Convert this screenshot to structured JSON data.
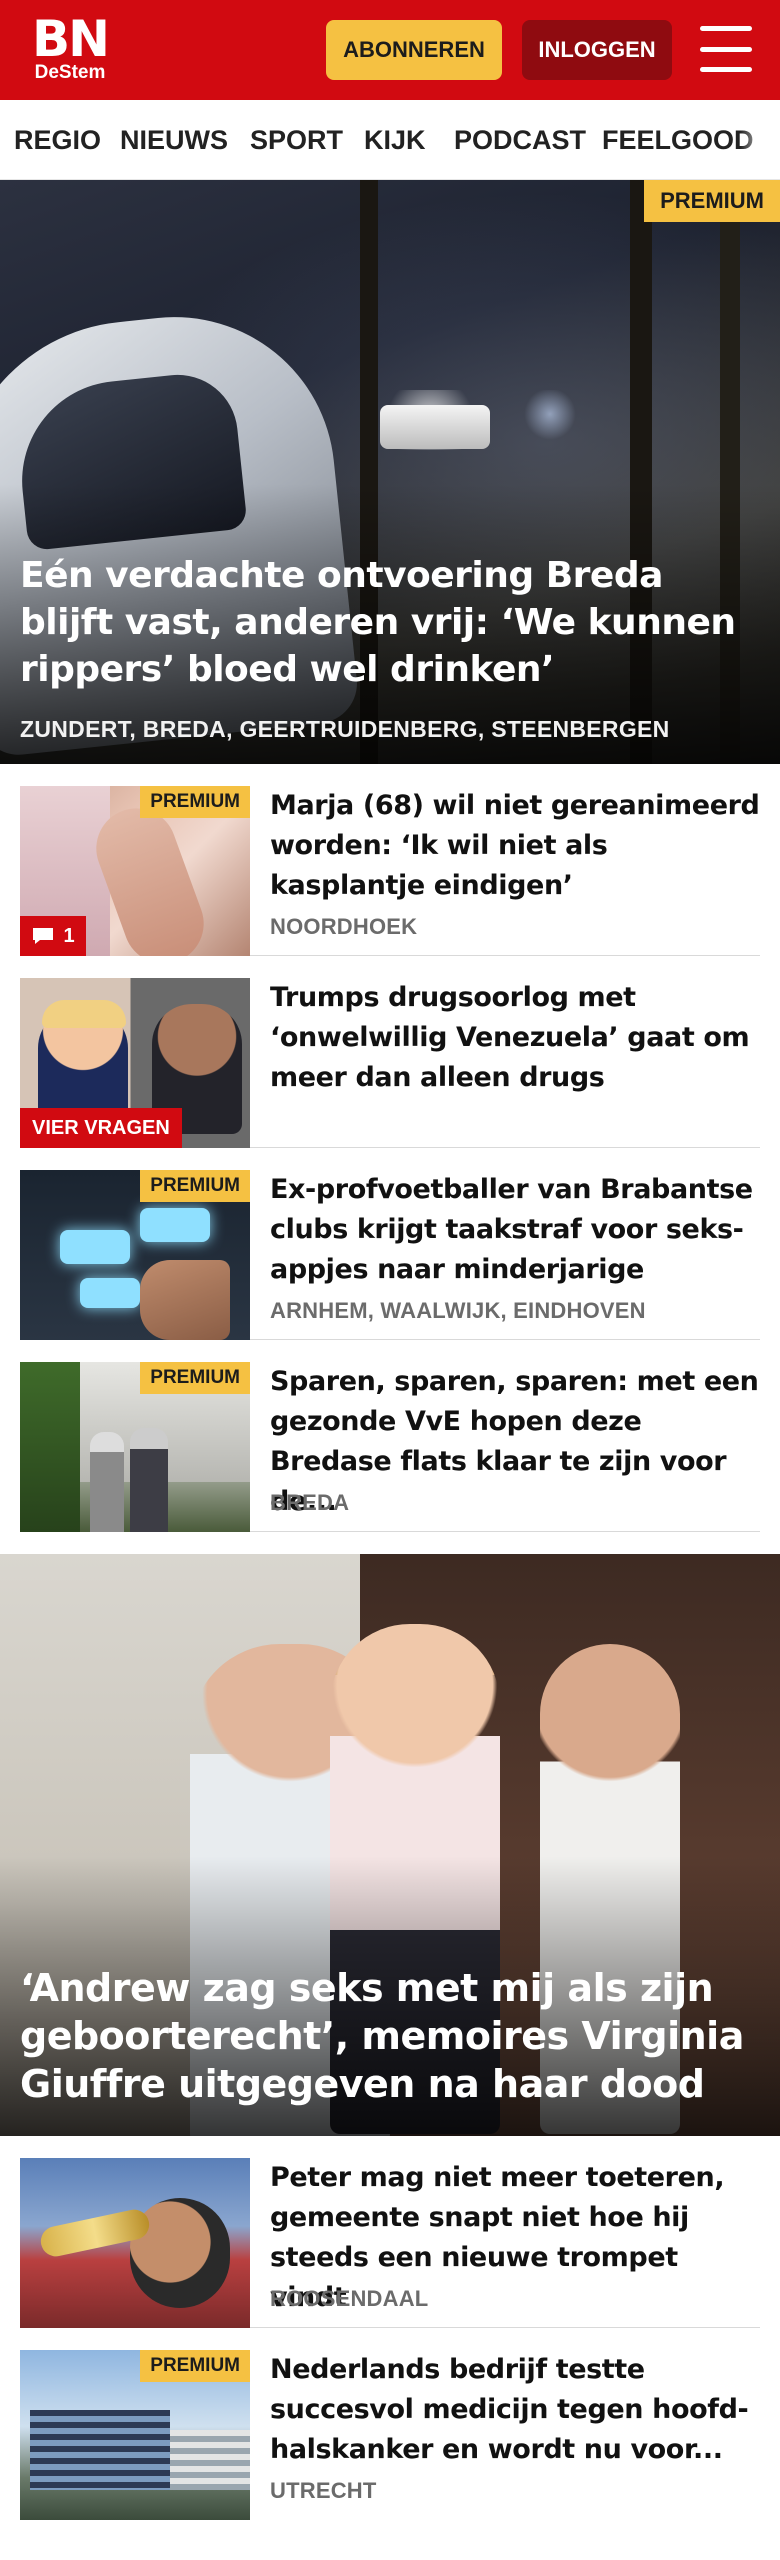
{
  "header": {
    "logo_main": "BN",
    "logo_sub": "DeStem",
    "subscribe_label": "ABONNEREN",
    "login_label": "INLOGGEN",
    "menu_icon": "hamburger-menu-icon",
    "brand_color": "#d10a11",
    "accent_color": "#f5c142"
  },
  "nav": {
    "items": [
      {
        "label": "REGIO"
      },
      {
        "label": "NIEUWS"
      },
      {
        "label": "SPORT"
      },
      {
        "label": "KIJK"
      },
      {
        "label": "PODCAST"
      },
      {
        "label": "FEELGOOD"
      }
    ]
  },
  "hero1": {
    "badge": "PREMIUM",
    "title": "Eén verdachte ontvoering Breda blijft vast, anderen vrij: ‘We kunnen rippers’ bloed wel drinken’",
    "location": "ZUNDERT, BREDA, GEERTRUIDENBERG, STEENBERGEN"
  },
  "articles1": [
    {
      "badge": "PREMIUM",
      "comments": "1",
      "title": "Marja (68) wil niet gereanimeerd worden: ‘Ik wil niet als kasplantje eindigen’",
      "location": "NOORDHOEK"
    },
    {
      "label": "VIER VRAGEN",
      "title": "Trumps drugsoorlog met ‘onwelwillig Venezuela’ gaat om meer dan alleen drugs"
    },
    {
      "badge": "PREMIUM",
      "title": "Ex-profvoetballer van Brabantse clubs krijgt taakstraf voor seks-appjes naar minderjarige",
      "location": "ARNHEM, WAALWIJK, EINDHOVEN"
    },
    {
      "badge": "PREMIUM",
      "title": "Sparen, sparen, sparen: met een gezonde VvE hopen deze Bredase flats klaar te zijn voor de...",
      "location": "BREDA"
    }
  ],
  "hero2": {
    "title": "‘Andrew zag seks met mij als zijn geboorterecht’, memoires Virginia Giuffre uitgegeven na haar dood"
  },
  "articles2": [
    {
      "title": "Peter mag niet meer toeteren, gemeente snapt niet hoe hij steeds een nieuwe trompet vindt",
      "location": "ROOSENDAAL"
    },
    {
      "badge": "PREMIUM",
      "title": "Nederlands bedrijf testte succesvol medicijn tegen hoofd-halskanker en wordt nu voor...",
      "location": "UTRECHT"
    }
  ]
}
